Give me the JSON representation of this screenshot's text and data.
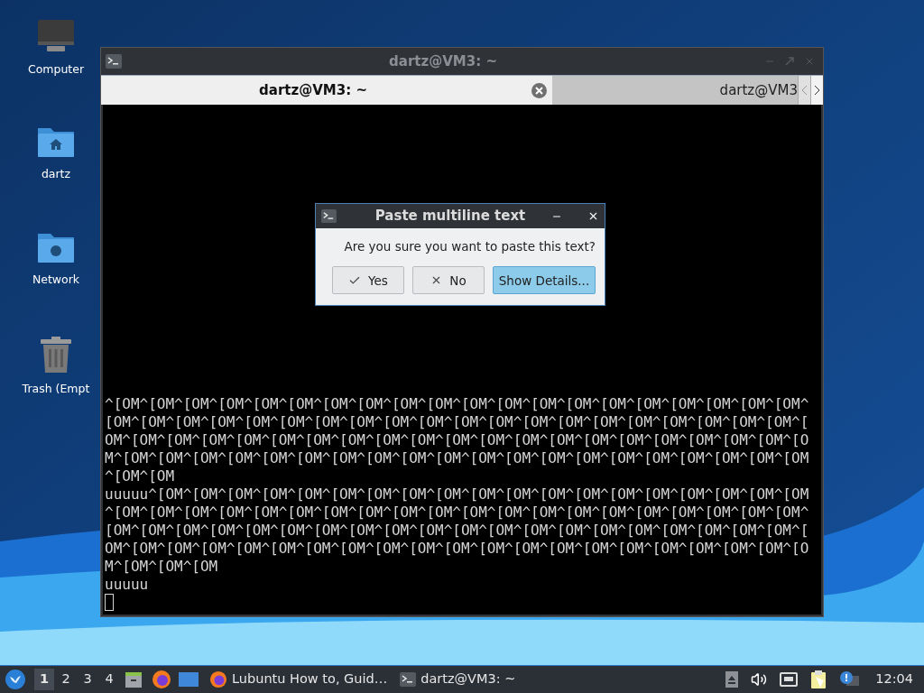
{
  "desktop_icons": [
    {
      "kind": "computer",
      "label": "Computer"
    },
    {
      "kind": "home",
      "label": "dartz"
    },
    {
      "kind": "network",
      "label": "Network"
    },
    {
      "kind": "trash",
      "label": "Trash (Empt"
    }
  ],
  "window": {
    "title": "dartz@VM3: ~",
    "tabs": [
      {
        "label": "dartz@VM3: ~",
        "selected": true
      },
      {
        "label": "dartz@VM3",
        "selected": false
      }
    ],
    "terminal_lines": [
      "^[OM^[OM^[OM^[OM^[OM^[OM^[OM^[OM^[OM^[OM^[OM^[OM^[OM^[OM^[OM^[OM^[OM^[OM^[OM^[OM^",
      "[OM^[OM^[OM^[OM^[OM^[OM^[OM^[OM^[OM^[OM^[OM^[OM^[OM^[OM^[OM^[OM^[OM^[OM^[OM^[OM^[",
      "OM^[OM^[OM^[OM^[OM^[OM^[OM^[OM^[OM^[OM^[OM^[OM^[OM^[OM^[OM^[OM^[OM^[OM^[OM^[OM^[O",
      "M^[OM^[OM^[OM^[OM^[OM^[OM^[OM^[OM^[OM^[OM^[OM^[OM^[OM^[OM^[OM^[OM^[OM^[OM^[OM^[OM",
      "^[OM^[OM",
      "uuuuu^[OM^[OM^[OM^[OM^[OM^[OM^[OM^[OM^[OM^[OM^[OM^[OM^[OM^[OM^[OM^[OM^[OM^[OM^[OM",
      "^[OM^[OM^[OM^[OM^[OM^[OM^[OM^[OM^[OM^[OM^[OM^[OM^[OM^[OM^[OM^[OM^[OM^[OM^[OM^[OM^",
      "[OM^[OM^[OM^[OM^[OM^[OM^[OM^[OM^[OM^[OM^[OM^[OM^[OM^[OM^[OM^[OM^[OM^[OM^[OM^[OM^[",
      "OM^[OM^[OM^[OM^[OM^[OM^[OM^[OM^[OM^[OM^[OM^[OM^[OM^[OM^[OM^[OM^[OM^[OM^[OM^[OM^[O",
      "M^[OM^[OM^[OM",
      "uuuuu"
    ]
  },
  "dialog": {
    "title": "Paste multiline text",
    "message": "Are you sure you want to paste this text?",
    "buttons": [
      {
        "kind": "yes",
        "label": "Yes",
        "selected": false
      },
      {
        "kind": "no",
        "label": "No",
        "selected": false
      },
      {
        "kind": "details",
        "label": "Show Details...",
        "selected": true
      }
    ]
  },
  "taskbar": {
    "workspaces": [
      {
        "label": "1",
        "selected": true
      },
      {
        "label": "2",
        "selected": false
      },
      {
        "label": "3",
        "selected": false
      },
      {
        "label": "4",
        "selected": false
      }
    ],
    "tasks": [
      {
        "kind": "browser",
        "label": "Lubuntu How to, Guid…"
      },
      {
        "kind": "terminal",
        "label": "dartz@VM3: ~"
      }
    ],
    "clock": "12:04"
  }
}
